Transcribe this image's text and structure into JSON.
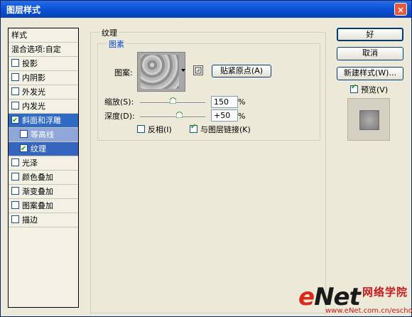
{
  "window": {
    "title": "图层样式",
    "close_glyph": "×"
  },
  "left_panel": {
    "header": "样式",
    "blend_label": "混合选项:自定",
    "items": [
      {
        "label": "投影",
        "checked": false
      },
      {
        "label": "内阴影",
        "checked": false
      },
      {
        "label": "外发光",
        "checked": false
      },
      {
        "label": "内发光",
        "checked": false
      },
      {
        "label": "斜面和浮雕",
        "checked": true
      },
      {
        "label": "等高线",
        "checked": false
      },
      {
        "label": "纹理",
        "checked": true
      },
      {
        "label": "光泽",
        "checked": false
      },
      {
        "label": "颜色叠加",
        "checked": false
      },
      {
        "label": "渐变叠加",
        "checked": false
      },
      {
        "label": "图案叠加",
        "checked": false
      },
      {
        "label": "描边",
        "checked": false
      }
    ]
  },
  "texture_group": {
    "title": "纹理",
    "sub_title": "图素",
    "pattern_label": "图案:",
    "snap_button": "贴紧原点(A)",
    "scale_label": "缩放(S):",
    "scale_value": "150",
    "scale_percent": 0.5,
    "scale_unit": "%",
    "depth_label": "深度(D):",
    "depth_value": "+50",
    "depth_percent": 0.6,
    "depth_unit": "%",
    "invert_label": "反相(I)",
    "invert_checked": false,
    "link_label": "与图层链接(K)",
    "link_checked": true
  },
  "right_panel": {
    "ok_label": "好",
    "cancel_label": "取消",
    "new_style_label": "新建样式(W)...",
    "preview_label": "预览(V)",
    "preview_checked": true
  },
  "watermark": {
    "logo_e": "e",
    "logo_net": "Net",
    "cn": "网络学院",
    "url": "www.eNet.com.cn/eschool"
  }
}
